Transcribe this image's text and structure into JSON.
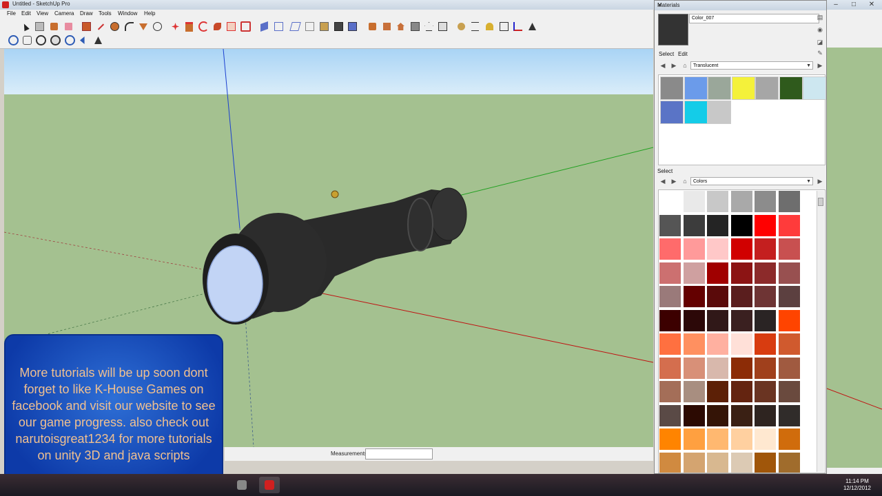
{
  "window": {
    "title": "Untitled - SketchUp Pro"
  },
  "menu": [
    "File",
    "Edit",
    "View",
    "Camera",
    "Draw",
    "Tools",
    "Window",
    "Help"
  ],
  "statusbar": {
    "measurements_label": "Measurements",
    "measurements_value": ""
  },
  "overlay": {
    "text": "More tutorials will be up soon dont forget to like K-House Games on facebook and visit our website to see our game progress. also check out narutoisgreat1234 for more tutorials on unity 3D and java scripts"
  },
  "materials": {
    "title": "Materials",
    "current_name": "Color_007",
    "tabs": {
      "select": "Select",
      "edit": "Edit"
    },
    "library": "Translucent",
    "select_label": "Select",
    "lower_library": "Colors",
    "translucent_swatches": [
      "#8a8a8a",
      "#6b9bea",
      "#9aa79a",
      "#f4f13a",
      "#a6a6a6",
      "#2f5a1c",
      "#cde7f0",
      "#5a74c6",
      "#14cce8",
      "#c8c8c8"
    ],
    "color_swatches": [
      "#ffffff",
      "#e9e9e9",
      "#c8c8c8",
      "#a9a9a9",
      "#8c8c8c",
      "#6e6e6e",
      "#555555",
      "#3c3c3c",
      "#242424",
      "#000000",
      "#ff0000",
      "#ff3b3b",
      "#ff6b6b",
      "#ff9a9a",
      "#ffc8c8",
      "#d10000",
      "#c41f1f",
      "#c85050",
      "#cc7070",
      "#cfa0a0",
      "#a00000",
      "#8c1414",
      "#8c2a2a",
      "#985050",
      "#9a7a7a",
      "#640000",
      "#5a0a0a",
      "#5a1e1e",
      "#6e3434",
      "#5c4040",
      "#3c0000",
      "#2c0808",
      "#301818",
      "#3a2020",
      "#2a2424",
      "#ff4400",
      "#ff7040",
      "#ff9060",
      "#ffb0a0",
      "#ffe0d8",
      "#d83c10",
      "#d05a2e",
      "#d46e4e",
      "#d89078",
      "#d8b8ac",
      "#8c2c06",
      "#a0401c",
      "#a05a40",
      "#a46e58",
      "#a88e80",
      "#5c2006",
      "#642410",
      "#6a3422",
      "#6a4a3e",
      "#5a4a46",
      "#2c0a02",
      "#341406",
      "#3a2014",
      "#2e2420",
      "#302c2a",
      "#ff8400",
      "#ffa040",
      "#ffb870",
      "#ffd0a0",
      "#ffe8d0",
      "#d06c0c",
      "#d08a40",
      "#d4a470",
      "#d8b890",
      "#dccab4",
      "#a0560a",
      "#a06c2c"
    ]
  },
  "taskbar": {
    "time": "11:14 PM",
    "date": "12/12/2012"
  },
  "colors": {
    "ground": "#a4c190",
    "sky": "#a9d4f5",
    "overlay_text": "#f0c090",
    "overlay_bg": "#1a4fc0"
  }
}
